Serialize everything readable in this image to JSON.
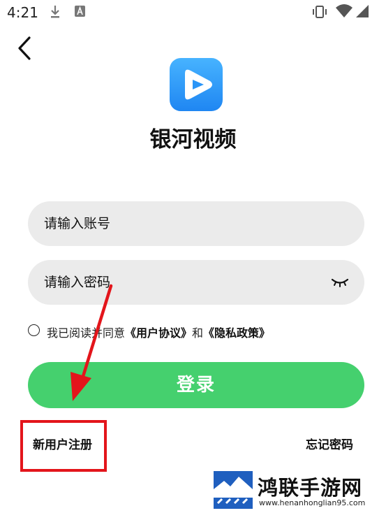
{
  "status_bar": {
    "time": "4:21",
    "icons": [
      "download-icon",
      "text-a-icon",
      "vibrate-icon",
      "wifi-icon",
      "signal-icon"
    ]
  },
  "app": {
    "title": "银河视频",
    "icon": "play-icon",
    "brand_color": "#2a95f7"
  },
  "form": {
    "account_placeholder": "请输入账号",
    "password_placeholder": "请输入密码",
    "agree_prefix": "我已阅读并同意",
    "user_agreement": "《用户协议》",
    "and": "和",
    "privacy_policy": "《隐私政策》",
    "login_label": "登录",
    "login_color": "#45d06e"
  },
  "footer": {
    "register_label": "新用户注册",
    "forgot_label": "忘记密码"
  },
  "annotation": {
    "highlight_color": "#e3151b"
  },
  "watermark": {
    "name": "鸿联手游网",
    "url": "www.henanhonglian95.com"
  }
}
